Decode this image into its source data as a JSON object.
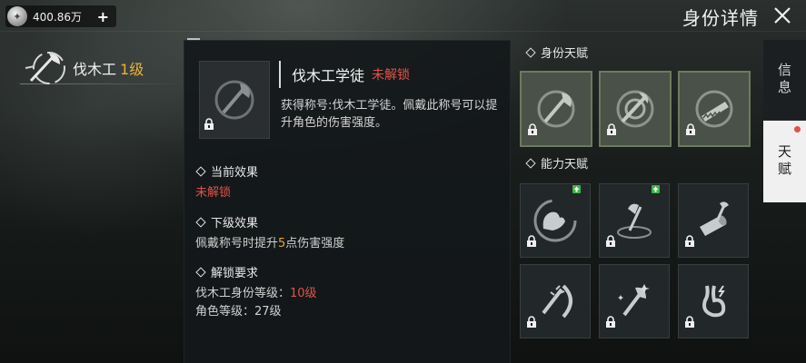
{
  "topbar": {
    "currency_value": "400.86万",
    "add_symbol": "+",
    "page_title": "身份详情"
  },
  "profession": {
    "name": "伐木工",
    "level": "1级"
  },
  "detail": {
    "title": "伐木工学徒",
    "status": "未解锁",
    "description": "获得称号:伐木工学徒。佩戴此称号可以提升角色的伤害强度。",
    "current_effect": {
      "heading": "当前效果",
      "text": "未解锁"
    },
    "next_effect": {
      "heading": "下级效果",
      "text_prefix": "佩戴称号时提升",
      "value": "5",
      "text_suffix": "点伤害强度"
    },
    "unlock_req": {
      "heading": "解锁要求",
      "line1_label": "伐木工身份等级：",
      "line1_value": "10级",
      "line2_label": "角色等级：",
      "line2_value": "27级"
    }
  },
  "grid": {
    "identity_heading": "身份天赋",
    "ability_heading": "能力天赋",
    "identity_cells": [
      {
        "icon": "axe-title-icon",
        "locked": true
      },
      {
        "icon": "axe-target-icon",
        "locked": true
      },
      {
        "icon": "saw-title-icon",
        "locked": true
      }
    ],
    "ability_cells": [
      {
        "icon": "strength-arm-icon",
        "locked": true,
        "upgrade": true
      },
      {
        "icon": "axe-chop-icon",
        "locked": true,
        "upgrade": true
      },
      {
        "icon": "log-cut-icon",
        "locked": true,
        "upgrade": false
      },
      {
        "icon": "spiked-club-icon",
        "locked": true,
        "upgrade": false
      },
      {
        "icon": "axe-spark-icon",
        "locked": true,
        "upgrade": false
      },
      {
        "icon": "stomach-icon",
        "locked": true,
        "upgrade": false
      }
    ]
  },
  "side_tabs": {
    "info": "信息",
    "talent": "天赋"
  },
  "colors": {
    "accent_gold": "#e8b23c",
    "status_red": "#e0524a",
    "value_orange": "#e8a33a",
    "upgrade_green": "#3fb44a"
  }
}
